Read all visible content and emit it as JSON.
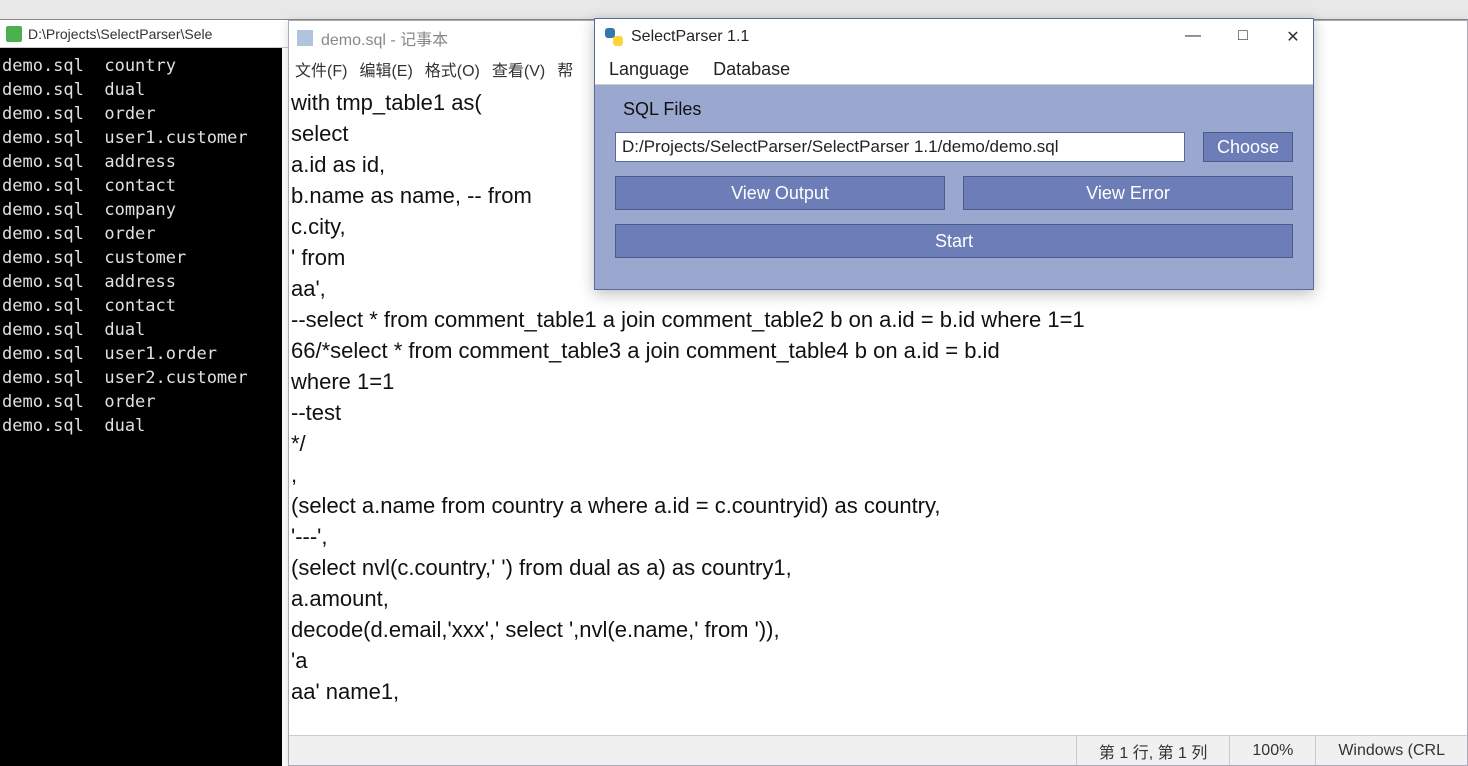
{
  "top_edge": "",
  "bg_window": {
    "title": "D:\\Projects\\SelectParser\\Sele"
  },
  "terminal": {
    "lines": [
      "demo.sql  country",
      "demo.sql  dual",
      "demo.sql  order",
      "demo.sql  user1.customer",
      "demo.sql  address",
      "demo.sql  contact",
      "demo.sql  company",
      "demo.sql  order",
      "demo.sql  customer",
      "demo.sql  address",
      "demo.sql  contact",
      "demo.sql  dual",
      "demo.sql  user1.order",
      "demo.sql  user2.customer",
      "demo.sql  order",
      "demo.sql  dual"
    ]
  },
  "notepad": {
    "title": "demo.sql - 记事本",
    "menu": [
      "文件(F)",
      "编辑(E)",
      "格式(O)",
      "查看(V)",
      "帮"
    ],
    "content": "with tmp_table1 as(\nselect\na.id as id,\nb.name as name, -- from\nc.city,\n' from\naa',\n--select * from comment_table1 a join comment_table2 b on a.id = b.id where 1=1\n66/*select * from comment_table3 a join comment_table4 b on a.id = b.id\nwhere 1=1\n--test\n*/\n,\n(select a.name from country a where a.id = c.countryid) as country,\n'---',\n(select nvl(c.country,' ') from dual as a) as country1,\na.amount,\ndecode(d.email,'xxx',' select ',nvl(e.name,' from ')),\n'a\naa' name1,",
    "status": {
      "pos": "第 1 行, 第 1 列",
      "zoom": "100%",
      "encoding": "Windows (CRL"
    }
  },
  "selectparser": {
    "title": "SelectParser 1.1",
    "menu": [
      "Language",
      "Database"
    ],
    "section_label": "SQL Files",
    "path": "D:/Projects/SelectParser/SelectParser 1.1/demo/demo.sql",
    "buttons": {
      "choose": "Choose",
      "view_output": "View Output",
      "view_error": "View Error",
      "start": "Start"
    },
    "winctl": {
      "min": "—",
      "max": "□",
      "close": "✕"
    }
  }
}
